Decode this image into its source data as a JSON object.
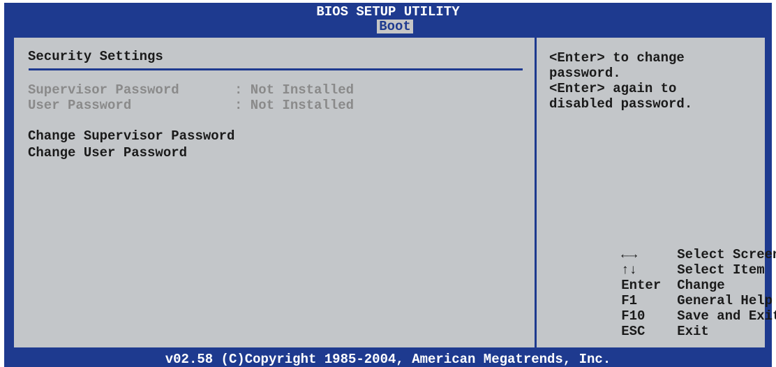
{
  "header": {
    "title": "BIOS SETUP UTILITY",
    "active_tab": "Boot"
  },
  "main": {
    "section_title": "Security Settings",
    "status_items": [
      {
        "label": "Supervisor Password",
        "value": ": Not Installed"
      },
      {
        "label": "User Password",
        "value": ": Not Installed"
      }
    ],
    "menu_items": [
      {
        "label": "Change Supervisor Password"
      },
      {
        "label": "Change User Password"
      }
    ]
  },
  "help": {
    "lines": [
      "<Enter> to change",
      "password.",
      "<Enter> again to",
      "disabled password."
    ]
  },
  "keys": [
    {
      "key": "←→",
      "action": "Select Screen",
      "icon": "left-right-arrows-icon"
    },
    {
      "key": "↑↓",
      "action": "Select Item",
      "icon": "up-down-arrows-icon"
    },
    {
      "key": "Enter",
      "action": "Change"
    },
    {
      "key": "F1",
      "action": "General Help"
    },
    {
      "key": "F10",
      "action": "Save and Exit"
    },
    {
      "key": "ESC",
      "action": "Exit"
    }
  ],
  "footer": {
    "copyright": "v02.58 (C)Copyright 1985-2004, American Megatrends, Inc."
  },
  "colors": {
    "frame_blue": "#1e3a8f",
    "panel_gray": "#c3c6c9",
    "disabled_text": "#8a8a8a",
    "text": "#1a1a1a"
  }
}
